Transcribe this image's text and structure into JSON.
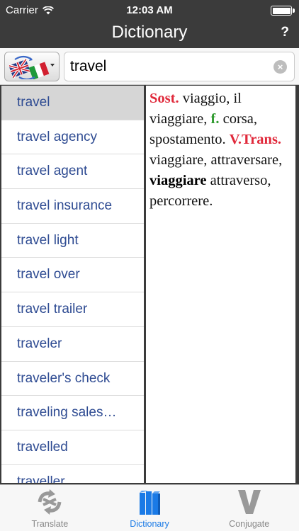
{
  "status_bar": {
    "carrier": "Carrier",
    "time": "12:03 AM"
  },
  "nav": {
    "title": "Dictionary",
    "help_label": "?"
  },
  "search": {
    "value": "travel",
    "clear_label": "×",
    "lang_icon": "uk-italy-flags-icon"
  },
  "results": [
    "travel",
    "travel agency",
    "travel agent",
    "travel insurance",
    "travel light",
    "travel over",
    "travel trailer",
    "traveler",
    "traveler's check",
    "traveling sales…",
    "travelled",
    "traveller"
  ],
  "selected_index": 0,
  "definition": {
    "pos1": "Sost.",
    "text1": " viaggio, il viaggiare, ",
    "gender": "f.",
    "text2": " corsa, spostamento. ",
    "pos2": "V.Trans.",
    "text3": " viaggiare, attraversare, ",
    "bold_term": "viaggiare",
    "text4": " attraverso, percorrere."
  },
  "tabs": [
    {
      "label": "Translate",
      "icon": "translate-icon",
      "active": false
    },
    {
      "label": "Dictionary",
      "icon": "books-icon",
      "active": true
    },
    {
      "label": "Conjugate",
      "icon": "conjugate-v-icon",
      "active": false
    }
  ],
  "colors": {
    "nav_background": "#3b3b3b",
    "list_text": "#2e4b92",
    "part_of_speech": "#e0283a",
    "gender_marker": "#2f9a2f",
    "active_tab": "#1a7ae6",
    "inactive_tab": "#888888"
  }
}
